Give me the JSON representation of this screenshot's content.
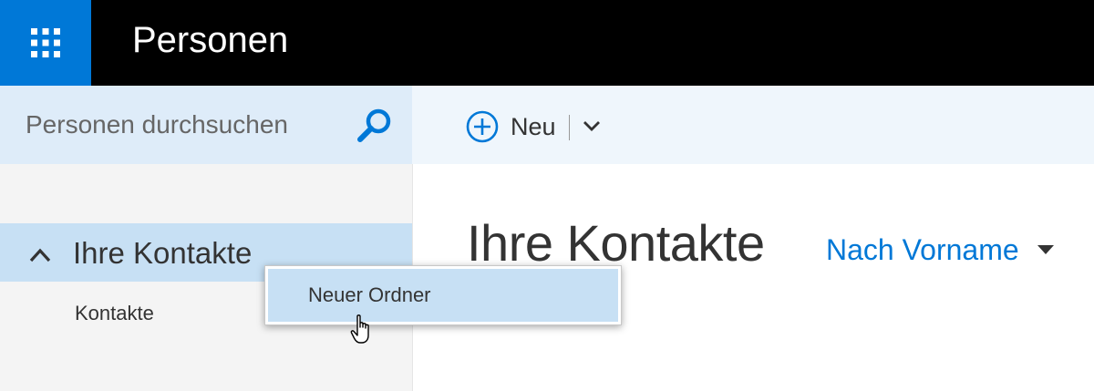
{
  "header": {
    "app_title": "Personen",
    "launcher_icon": "waffle-icon"
  },
  "search": {
    "placeholder": "Personen durchsuchen",
    "value": "",
    "icon": "search-icon"
  },
  "toolbar": {
    "new_label": "Neu",
    "new_icon": "plus-circle-icon",
    "dropdown_icon": "chevron-down-icon"
  },
  "sidebar": {
    "group_label": "Ihre Kontakte",
    "group_icon": "chevron-up-icon",
    "items": [
      {
        "label": "Kontakte"
      }
    ]
  },
  "main": {
    "title": "Ihre Kontakte",
    "sort_label": "Nach Vorname",
    "sort_icon": "caret-down-icon"
  },
  "context_menu": {
    "items": [
      {
        "label": "Neuer Ordner"
      }
    ]
  },
  "colors": {
    "accent": "#0078d7",
    "topbar": "#000000",
    "search_bg": "#deecf9",
    "command_bg": "#eff6fc",
    "nav_bg": "#f4f4f4",
    "selected": "#c7e0f4"
  }
}
